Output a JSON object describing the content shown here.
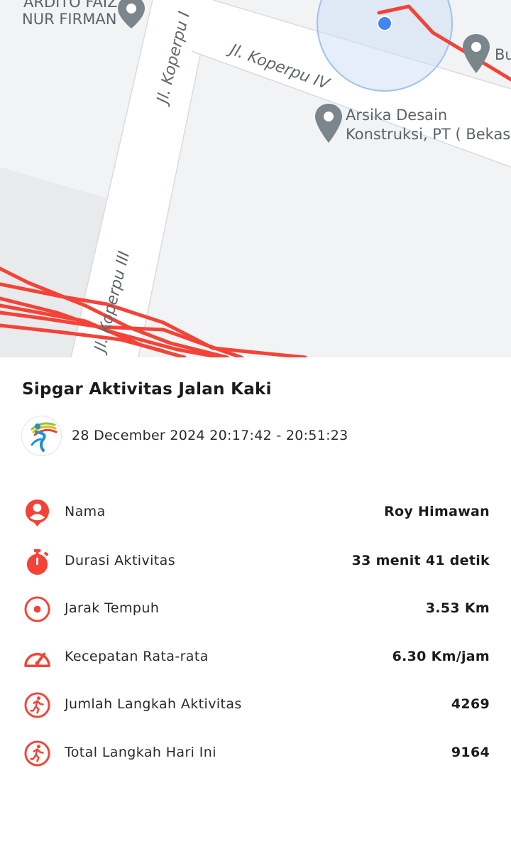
{
  "map": {
    "streets": {
      "koperpu_iv": "Jl. Koperpu IV",
      "koperpu_iii": "Jl. Koperpu III",
      "koperpu_top": "Jl. Koperpu I"
    },
    "places": {
      "ardito_line1": "ARDITO FAIZ",
      "ardito_line2": "NUR FIRMAN",
      "arsika_line1": "Arsika Desain",
      "arsika_line2": "Konstruksi, PT ( Bekasi )",
      "bu_label": "Bu"
    },
    "route_color": "#f44336",
    "location_dot_color": "#4285f4"
  },
  "activity": {
    "title": "Sipgar Aktivitas Jalan Kaki",
    "time_range": "28 December 2024 20:17:42 - 20:51:23"
  },
  "stats": [
    {
      "icon": "person-icon",
      "label": "Nama",
      "value": "Roy Himawan"
    },
    {
      "icon": "stopwatch-icon",
      "label": "Durasi Aktivitas",
      "value": "33 menit 41 detik"
    },
    {
      "icon": "target-icon",
      "label": "Jarak Tempuh",
      "value": "3.53 Km"
    },
    {
      "icon": "speedometer-icon",
      "label": "Kecepatan Rata-rata",
      "value": "6.30 Km/jam"
    },
    {
      "icon": "running-icon",
      "label": "Jumlah Langkah Aktivitas",
      "value": "4269"
    },
    {
      "icon": "running-icon",
      "label": "Total Langkah Hari Ini",
      "value": "9164"
    }
  ],
  "colors": {
    "accent": "#f44336",
    "text": "#1c1c1c"
  }
}
